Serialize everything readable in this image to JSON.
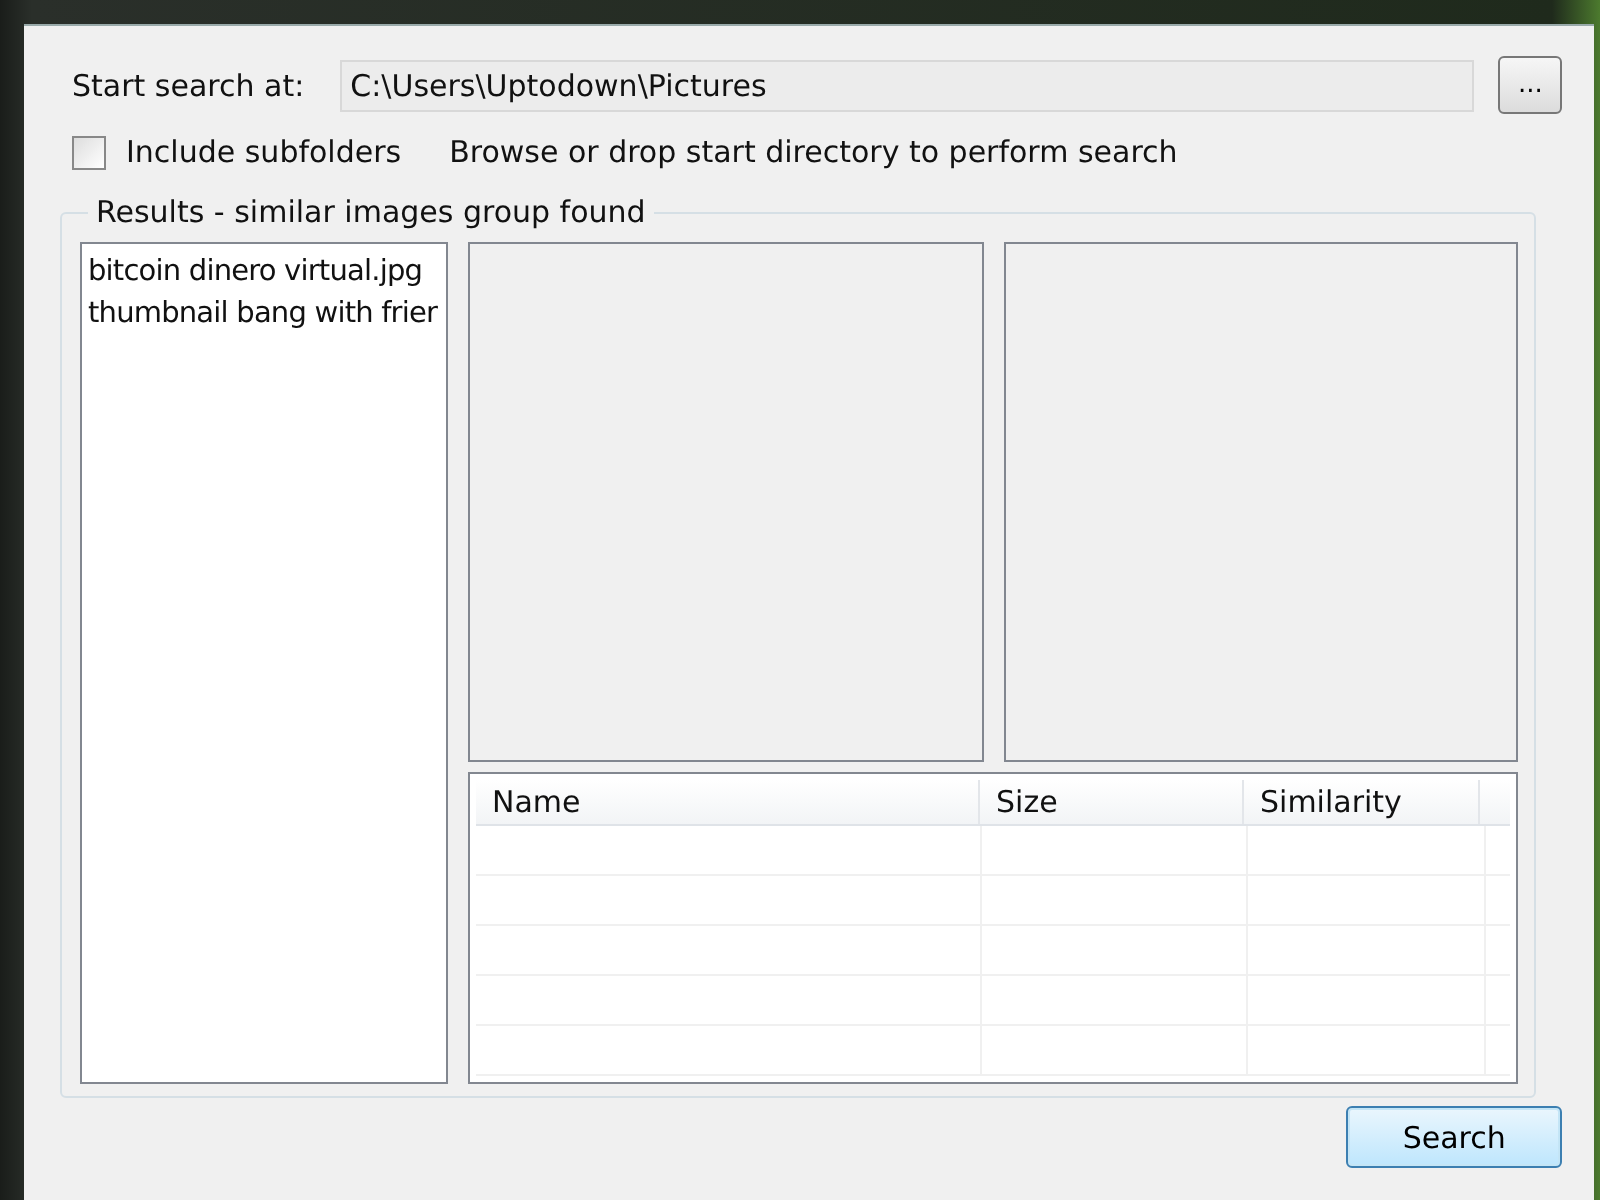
{
  "search_bar": {
    "label": "Start search at:",
    "path": "C:\\Users\\Uptodown\\Pictures",
    "browse_button": "..."
  },
  "options": {
    "include_subfolders": {
      "label": "Include subfolders",
      "checked": false
    },
    "hint": "Browse or drop start directory to perform search"
  },
  "results": {
    "title": "Results - similar images group found",
    "groups": [
      {
        "name": "bitcoin dinero virtual.jpg",
        "selected": false
      },
      {
        "name": "thumbnail bang with frier",
        "selected": false
      }
    ],
    "table": {
      "columns": [
        "Name",
        "Size",
        "Similarity"
      ]
    }
  },
  "buttons": {
    "search": "Search"
  }
}
